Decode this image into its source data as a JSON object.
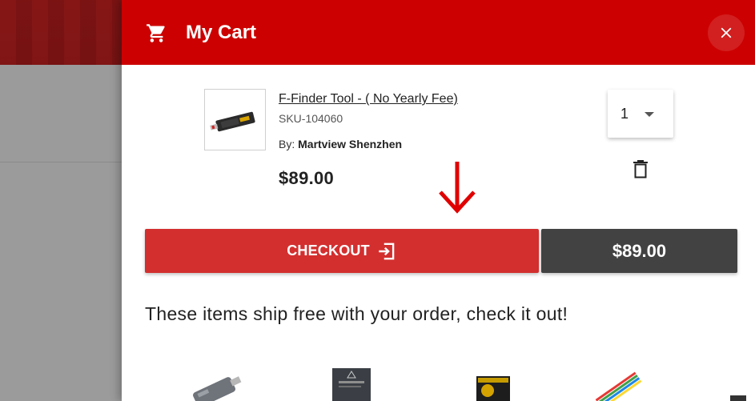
{
  "cart": {
    "title": "My Cart",
    "close_label": "Close cart"
  },
  "item": {
    "name": "F-Finder Tool - ( No Yearly Fee)",
    "sku": "SKU-104060",
    "by_label": "By:",
    "seller": "Martview Shenzhen",
    "price": "$89.00",
    "quantity": "1"
  },
  "checkout": {
    "label": "CHECKOUT",
    "total": "$89.00"
  },
  "recommendations": {
    "heading": "These items ship free with your order, check it out!"
  },
  "colors": {
    "header": "#cc0000",
    "checkout": "#d32f2f",
    "total": "#424242",
    "annotation_arrow": "#e00000"
  },
  "icons": {
    "cart": "cart-icon",
    "close": "close-icon",
    "trash": "trash-icon",
    "checkout": "exit-arrow-icon",
    "annotation": "down-arrow-icon"
  }
}
